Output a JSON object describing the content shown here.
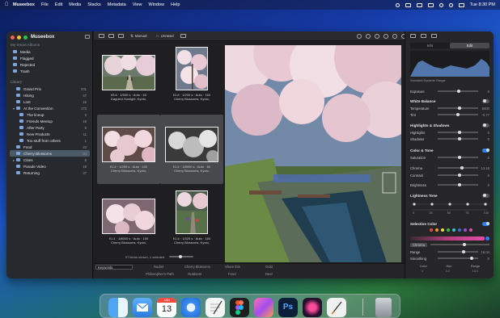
{
  "menubar": {
    "app_name": "Museebox",
    "items": [
      "File",
      "Edit",
      "Media",
      "Stacks",
      "Metadata",
      "View",
      "Window",
      "Help"
    ],
    "clock": "Tue 8:30 PM"
  },
  "sidebar": {
    "app_title": "Museebox",
    "smart_section": "My Smart Albums",
    "smart_items": [
      {
        "label": "Media"
      },
      {
        "label": "Flagged"
      },
      {
        "label": "Rejected"
      },
      {
        "label": "Trash"
      }
    ],
    "library_section": "Library",
    "library_items": [
      {
        "label": "Grand Prix",
        "count": "231"
      },
      {
        "label": "Hiking",
        "count": "47"
      },
      {
        "label": "Lost",
        "count": "16"
      },
      {
        "label": "At the Convention",
        "count": "173"
      },
      {
        "label": "The lineup",
        "count": "3"
      },
      {
        "label": "Friends Meetup",
        "count": "18"
      },
      {
        "label": "After Party",
        "count": "5"
      },
      {
        "label": "New Products",
        "count": "11"
      },
      {
        "label": "Too stuff from others",
        "count": "1"
      },
      {
        "label": "Food",
        "count": "23"
      },
      {
        "label": "Cherry Blossoms",
        "count": "34"
      },
      {
        "label": "Cities",
        "count": "8"
      },
      {
        "label": "Parade Video",
        "count": "19"
      },
      {
        "label": "Returning",
        "count": "37"
      }
    ]
  },
  "toolbar": {
    "sort_label": "Manual",
    "filter_label": "Unrated"
  },
  "grid": {
    "thumbs": [
      {
        "meta": "f/5.6 · 1/500 s · Auto · 64",
        "title": "Dappled Sunlight, Kyoto,"
      },
      {
        "meta": "f/2.8 · 1/200 s · Auto · 160",
        "title": "Cherry Blossoms, Kyoto,"
      },
      {
        "meta": "f/1.4 · 1/200 s · Auto · 100",
        "title": "Cherry Blossoms, Kyoto,"
      },
      {
        "meta": "f/1.4 · 1/8000 s · Auto · 80",
        "title": "Cherry Blossoms, Kyoto,"
      },
      {
        "meta": "f/1.4 · 1/8000 s · Auto · 100",
        "title": "Cherry Blossoms, Kyoto,"
      },
      {
        "meta": "f/1.4 · 1/320 s · Auto · 160",
        "title": "Cherry Blossoms, Kyoto,"
      }
    ],
    "footer_status": "97 items shown, 1 selected"
  },
  "metadata_bar": {
    "keyword_value": "Keywords",
    "labels": [
      "Nudist",
      "Cherry Blossoms",
      "Share this",
      "Gold",
      "Philosopher's Path",
      "Outdoors",
      "Food",
      "Deer"
    ]
  },
  "inspector": {
    "tabs": [
      "Info",
      "Edit"
    ],
    "active_tab": "Edit",
    "histogram_label": "Standard Dynamic Range",
    "rows": [
      {
        "label": "Exposure",
        "value": "0"
      },
      {
        "label": "Temperature",
        "value": "6500"
      },
      {
        "label": "Tint",
        "value": "-0.77"
      },
      {
        "label": "Highlights",
        "value": "0"
      },
      {
        "label": "Shadows",
        "value": "0"
      },
      {
        "label": "Saturation",
        "value": "0"
      },
      {
        "label": "Chroma",
        "value": "13.18"
      },
      {
        "label": "Contrast",
        "value": "0"
      },
      {
        "label": "Brightness",
        "value": "0"
      },
      {
        "label": "Range",
        "value": "16.04"
      },
      {
        "label": "Smoothing",
        "value": "0"
      }
    ],
    "sections": [
      "White Balance",
      "Highlights & Shadows",
      "Color & Tone",
      "Lightness Tone",
      "Selective Color"
    ],
    "lightness_values": [
      "0",
      "25",
      "50",
      "75",
      "100"
    ],
    "selective_color_swatches": [
      "#e84a4a",
      "#f09b32",
      "#f3dd3c",
      "#3fbf4b",
      "#38c3d6",
      "#3c6de6",
      "#9b4fe0",
      "#e24ca8"
    ],
    "selected_hue": "Chroma",
    "bottom_labels": [
      "Color",
      "Hue",
      "Range"
    ],
    "bottom_values": [
      "0",
      "0.0",
      "16.0"
    ]
  },
  "dock": {
    "apps": [
      "Finder",
      "Mail",
      "Calendar",
      "Safari",
      "TextEdit",
      "Figma",
      "Museebox",
      "Photoshop",
      "Lightroom",
      "Pages",
      "Trash"
    ],
    "calendar_month": "JAN",
    "calendar_day": "13"
  },
  "colors": {
    "accent": "#2f7ef2",
    "selection": "#4a5a68",
    "window_bg": "#1e1e20"
  }
}
